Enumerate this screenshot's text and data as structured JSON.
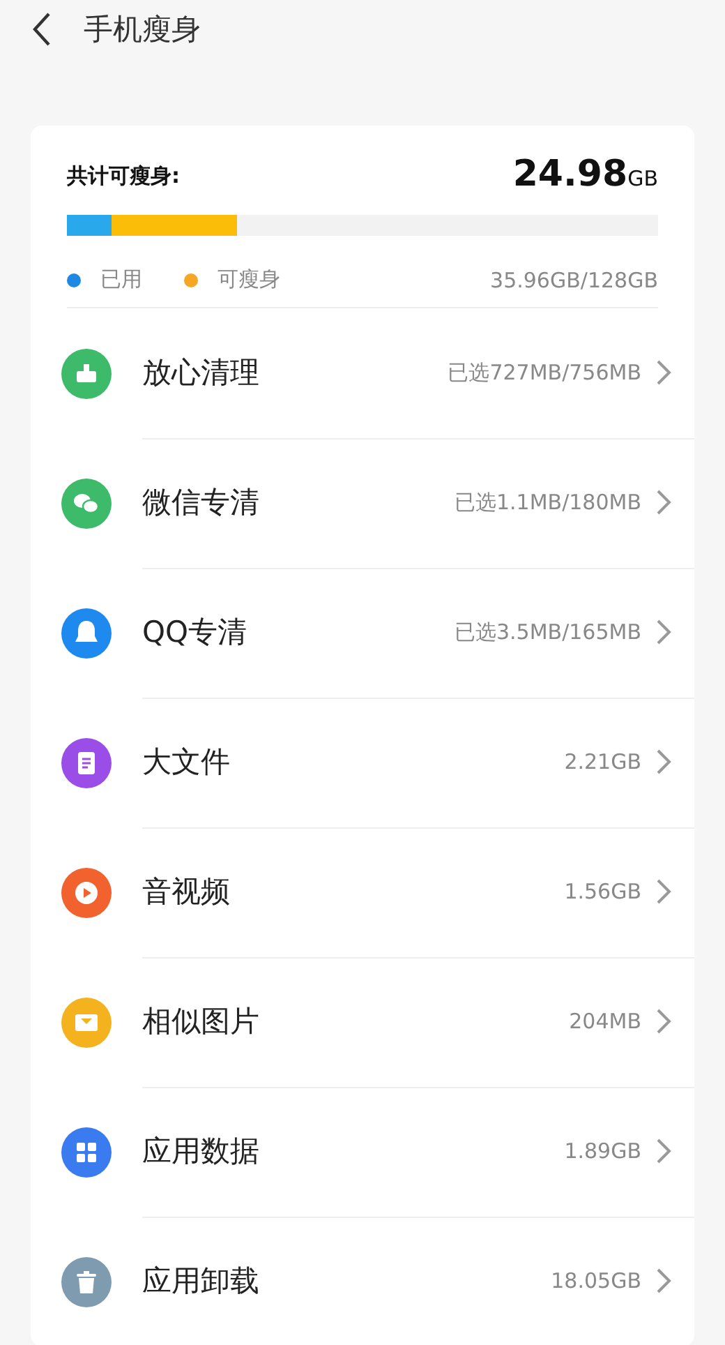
{
  "header": {
    "title": "手机瘦身"
  },
  "summary": {
    "label": "共计可瘦身:",
    "amount": "24.98",
    "unit": "GB",
    "bar": [
      {
        "color": "#2aa8ec",
        "level": 0.076
      },
      {
        "color": "#fbbd08",
        "level": 0.212
      }
    ],
    "legend": [
      {
        "label": "已用",
        "color": "#1e88e5"
      },
      {
        "label": "可瘦身",
        "color": "#f5a623"
      }
    ],
    "usage": "35.96GB/128GB"
  },
  "items": [
    {
      "label": "放心清理",
      "value": "已选727MB/756MB",
      "color": "#3dbb6b"
    },
    {
      "label": "微信专清",
      "value": "已选1.1MB/180MB",
      "color": "#3dbb6b"
    },
    {
      "label": "QQ专清",
      "value": "已选3.5MB/165MB",
      "color": "#1e8af0"
    },
    {
      "label": "大文件",
      "value": "2.21GB",
      "color": "#9b4de8"
    },
    {
      "label": "音视频",
      "value": "1.56GB",
      "color": "#f2622e"
    },
    {
      "label": "相似图片",
      "value": "204MB",
      "color": "#f5b21f"
    },
    {
      "label": "应用数据",
      "value": "1.89GB",
      "color": "#3a7bf0"
    },
    {
      "label": "应用卸载",
      "value": "18.05GB",
      "color": "#7f9bb0"
    }
  ]
}
